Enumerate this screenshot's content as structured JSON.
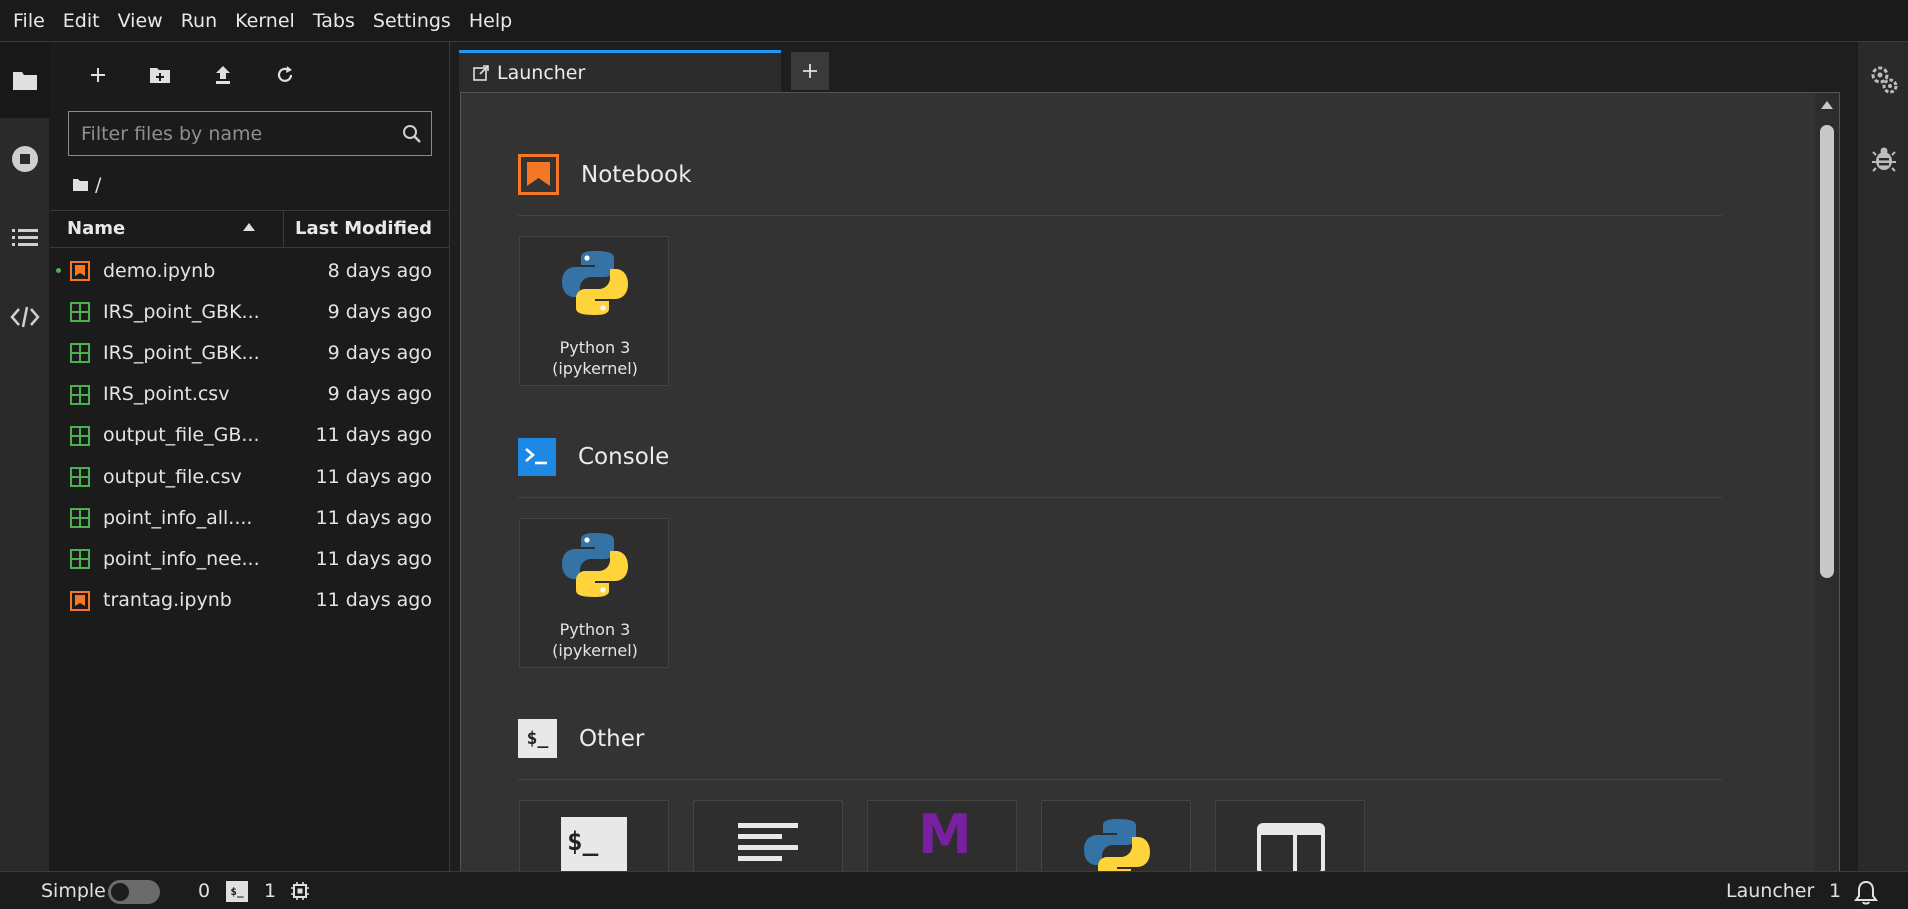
{
  "menubar": {
    "items": [
      "File",
      "Edit",
      "View",
      "Run",
      "Kernel",
      "Tabs",
      "Settings",
      "Help"
    ]
  },
  "left_sidebar": {
    "icons": [
      "folder-icon",
      "running-sessions-icon",
      "table-of-contents-icon",
      "code-extensions-icon"
    ]
  },
  "filebrowser": {
    "toolbar": [
      "new-launcher-icon",
      "new-folder-icon",
      "upload-icon",
      "refresh-icon"
    ],
    "search_placeholder": "Filter files by name",
    "breadcrumb": "/",
    "header": {
      "name": "Name",
      "modified": "Last Modified"
    },
    "files": [
      {
        "name": "demo.ipynb",
        "modified": "8 days ago",
        "type": "notebook",
        "running": true
      },
      {
        "name": "IRS_point_GBK...",
        "modified": "9 days ago",
        "type": "csv",
        "running": false
      },
      {
        "name": "IRS_point_GBK...",
        "modified": "9 days ago",
        "type": "csv",
        "running": false
      },
      {
        "name": "IRS_point.csv",
        "modified": "9 days ago",
        "type": "csv",
        "running": false
      },
      {
        "name": "output_file_GB...",
        "modified": "11 days ago",
        "type": "csv",
        "running": false
      },
      {
        "name": "output_file.csv",
        "modified": "11 days ago",
        "type": "csv",
        "running": false
      },
      {
        "name": "point_info_all....",
        "modified": "11 days ago",
        "type": "csv",
        "running": false
      },
      {
        "name": "point_info_nee...",
        "modified": "11 days ago",
        "type": "csv",
        "running": false
      },
      {
        "name": "trantag.ipynb",
        "modified": "11 days ago",
        "type": "notebook",
        "running": false
      }
    ]
  },
  "tabs": {
    "active": "Launcher",
    "add_label": "+"
  },
  "launcher": {
    "sections": {
      "notebook": {
        "title": "Notebook",
        "cards": [
          {
            "line1": "Python 3",
            "line2": "(ipykernel)"
          }
        ]
      },
      "console": {
        "title": "Console",
        "cards": [
          {
            "line1": "Python 3",
            "line2": "(ipykernel)"
          }
        ]
      },
      "other": {
        "title": "Other",
        "icon_text": "$_",
        "cards": [
          "terminal-icon",
          "text-file-icon",
          "markdown-icon",
          "python-file-icon",
          "show-contextual-help-icon"
        ]
      }
    },
    "markdown_glyph": "M",
    "terminal_glyph": "$_"
  },
  "statusbar": {
    "mode_label": "Simple",
    "simple_mode_on": false,
    "terminals_count": "0",
    "terminal_badge": "$_",
    "kernels_count": "1",
    "active_label": "Launcher",
    "notifications_count": "1"
  },
  "colors": {
    "accent": "#2196f3",
    "notebook_orange": "#f37726",
    "csv_green": "#4caf50",
    "python_blue": "#3572a5",
    "python_yellow": "#ffd43b",
    "markdown_purple": "#7b1fa2"
  }
}
